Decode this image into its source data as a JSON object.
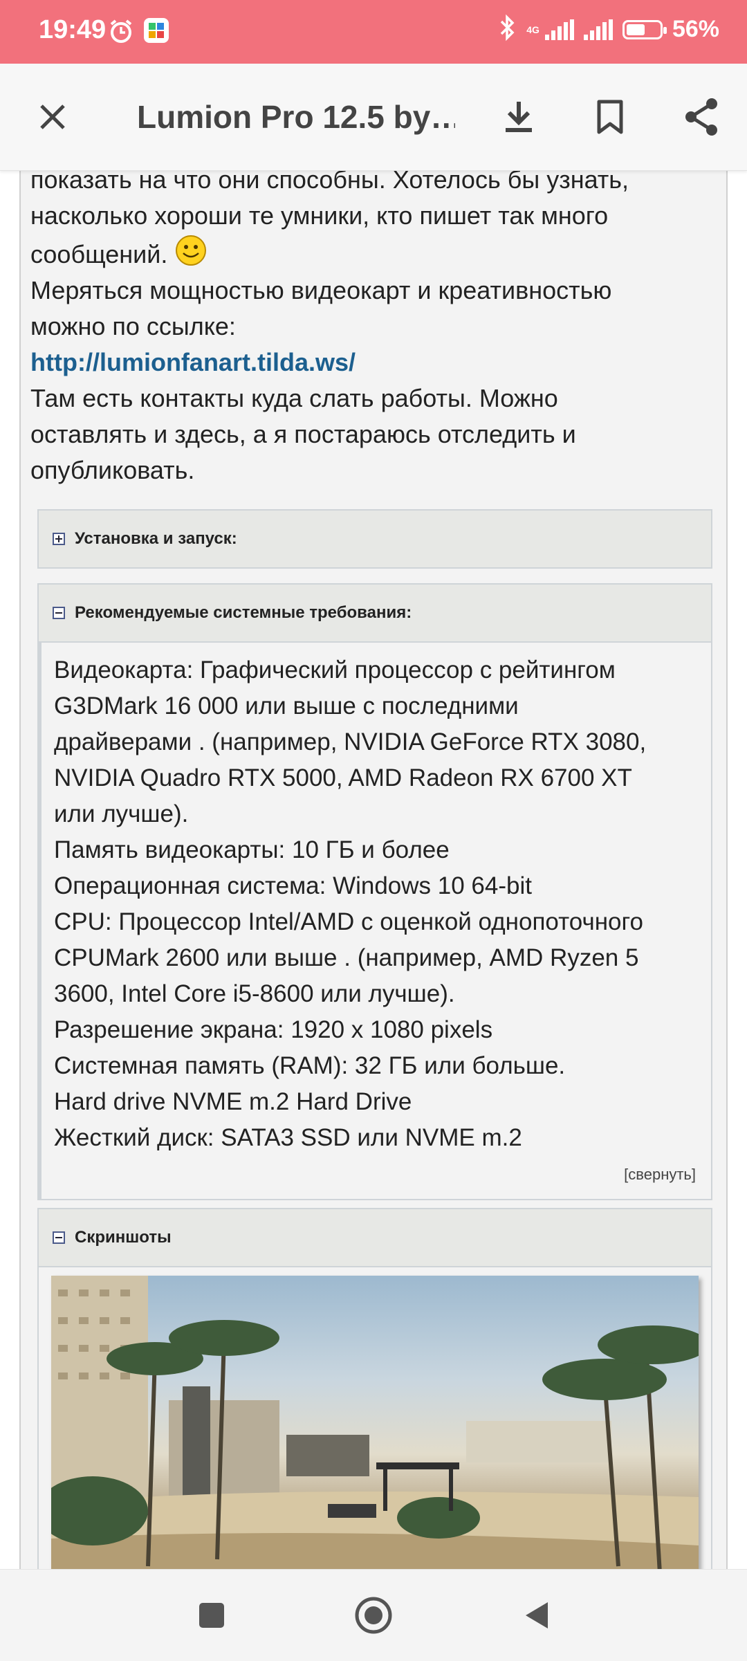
{
  "status_bar": {
    "time": "19:49",
    "network": "4G",
    "battery_percent": "56%",
    "battery_level": 0.56,
    "background_color": "#f2717c"
  },
  "toolbar": {
    "title": "Lumion Pro 12.5 by…",
    "icons": [
      "close-icon",
      "download-icon",
      "bookmark-icon",
      "share-icon"
    ]
  },
  "intro": {
    "line1": "показать на что они способны. Хотелось бы узнать,",
    "line2": "насколько хороши те умники, кто пишет так много",
    "line3": "сообщений.",
    "line4": "Меряться мощностью видеокарт и креативностью",
    "line5": "можно по ссылке:",
    "link": "http://lumionfanart.tilda.ws/",
    "line6": "Там есть контакты куда слать работы. Можно",
    "line7": "оставлять и здесь, а я постараюсь отследить и",
    "line8": "опубликовать."
  },
  "spoilers": {
    "install": {
      "title": "Установка и запуск:"
    },
    "requirements": {
      "title": "Рекомендуемые системные требования:",
      "lines": [
        "Видеокарта: Графический процессор с рейтингом",
        "G3DMark 16 000 или выше с последними",
        "драйверами . (например, NVIDIA GeForce RTX 3080,",
        "NVIDIA Quadro RTX 5000, AMD Radeon RX 6700 XT",
        "или лучше).",
        "Память видеокарты: 10 ГБ и более",
        "Операционная система: Windows 10 64-bit",
        "CPU: Процессор Intel/AMD с оценкой однопоточного",
        "CPUMark 2600 или выше . (например, AMD Ryzen 5",
        "3600, Intel Core i5-8600 или лучше).",
        "Разрешение экрана: 1920 x 1080 pixels",
        "Системная память (RAM): 32 ГБ или больше.",
        "Hard drive NVME m.2 Hard Drive",
        "Жесткий диск: SATA3 SSD или NVME m.2"
      ],
      "collapse_label": "[свернуть]"
    },
    "screenshots": {
      "title": "Скриншоты"
    }
  },
  "navbar": {
    "icons": [
      "recents-square-icon",
      "home-circle-icon",
      "back-triangle-icon"
    ]
  }
}
